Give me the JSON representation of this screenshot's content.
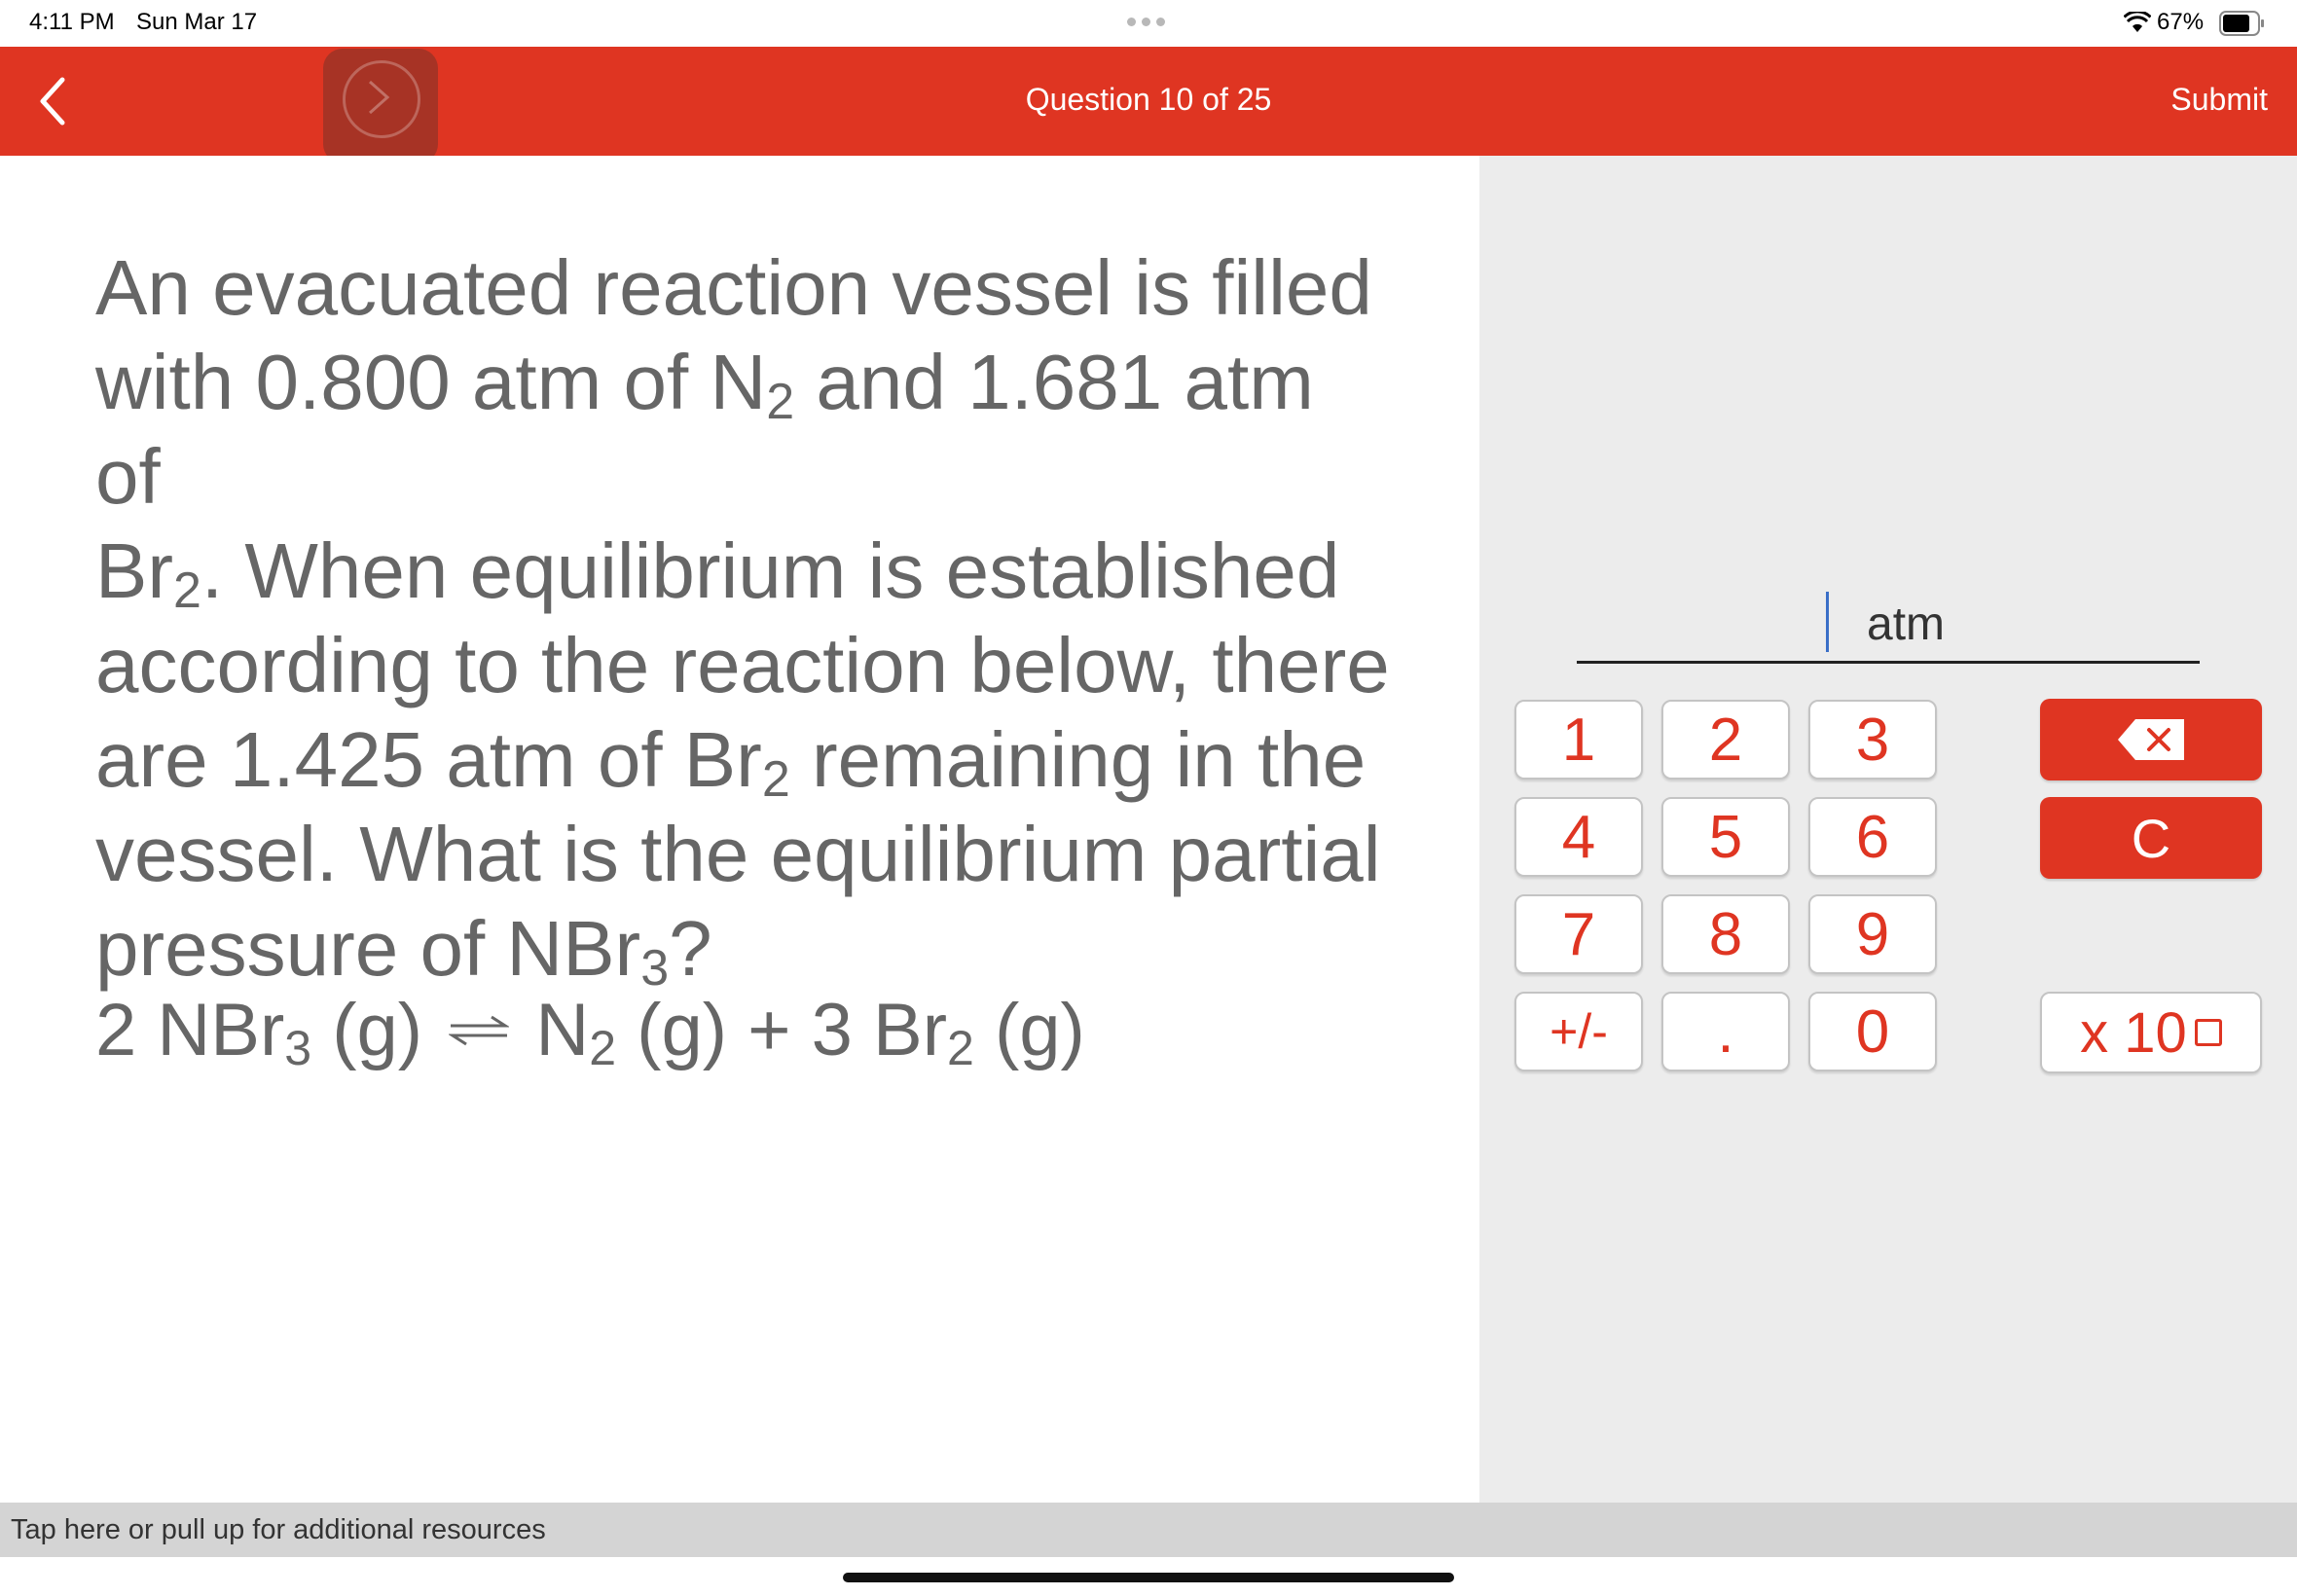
{
  "status": {
    "time": "4:11 PM",
    "date": "Sun Mar 17",
    "battery": "67%"
  },
  "header": {
    "title": "Question 10 of 25",
    "submit_label": "Submit",
    "accent_color": "#df3522"
  },
  "question": {
    "l1": "An evacuated reaction vessel is filled",
    "l2a": "with 0.800 atm of N",
    "l2s": "2",
    "l2b": " and 1.681 atm of",
    "l3a": "Br",
    "l3s": "2",
    "l3b": ". When equilibrium is established",
    "l4": "according to the reaction below, there",
    "l5a": "are 1.425 atm of Br",
    "l5s": "2",
    "l5b": " remaining in the",
    "l6": "vessel. What is the equilibrium partial",
    "l7a": "pressure of NBr",
    "l7s": "3",
    "l7b": "?"
  },
  "equation": {
    "p1": "2 NBr",
    "s1": "3",
    "p2": " (g) ",
    "p3": " N",
    "s2": "2",
    "p4": " (g) + 3 Br",
    "s3": "2",
    "p5": " (g)",
    "arrow_icon": "equilibrium-arrow"
  },
  "answer": {
    "value": "",
    "unit": "atm"
  },
  "keypad": {
    "k1": "1",
    "k2": "2",
    "k3": "3",
    "k4": "4",
    "k5": "5",
    "k6": "6",
    "k7": "7",
    "k8": "8",
    "k9": "9",
    "k_sign": "+/-",
    "k_dot": ".",
    "k0": "0",
    "clear": "C",
    "exp": "x 10",
    "backspace_icon": "backspace-icon"
  },
  "footer": {
    "resources_text": "Tap here or pull up for additional resources"
  }
}
